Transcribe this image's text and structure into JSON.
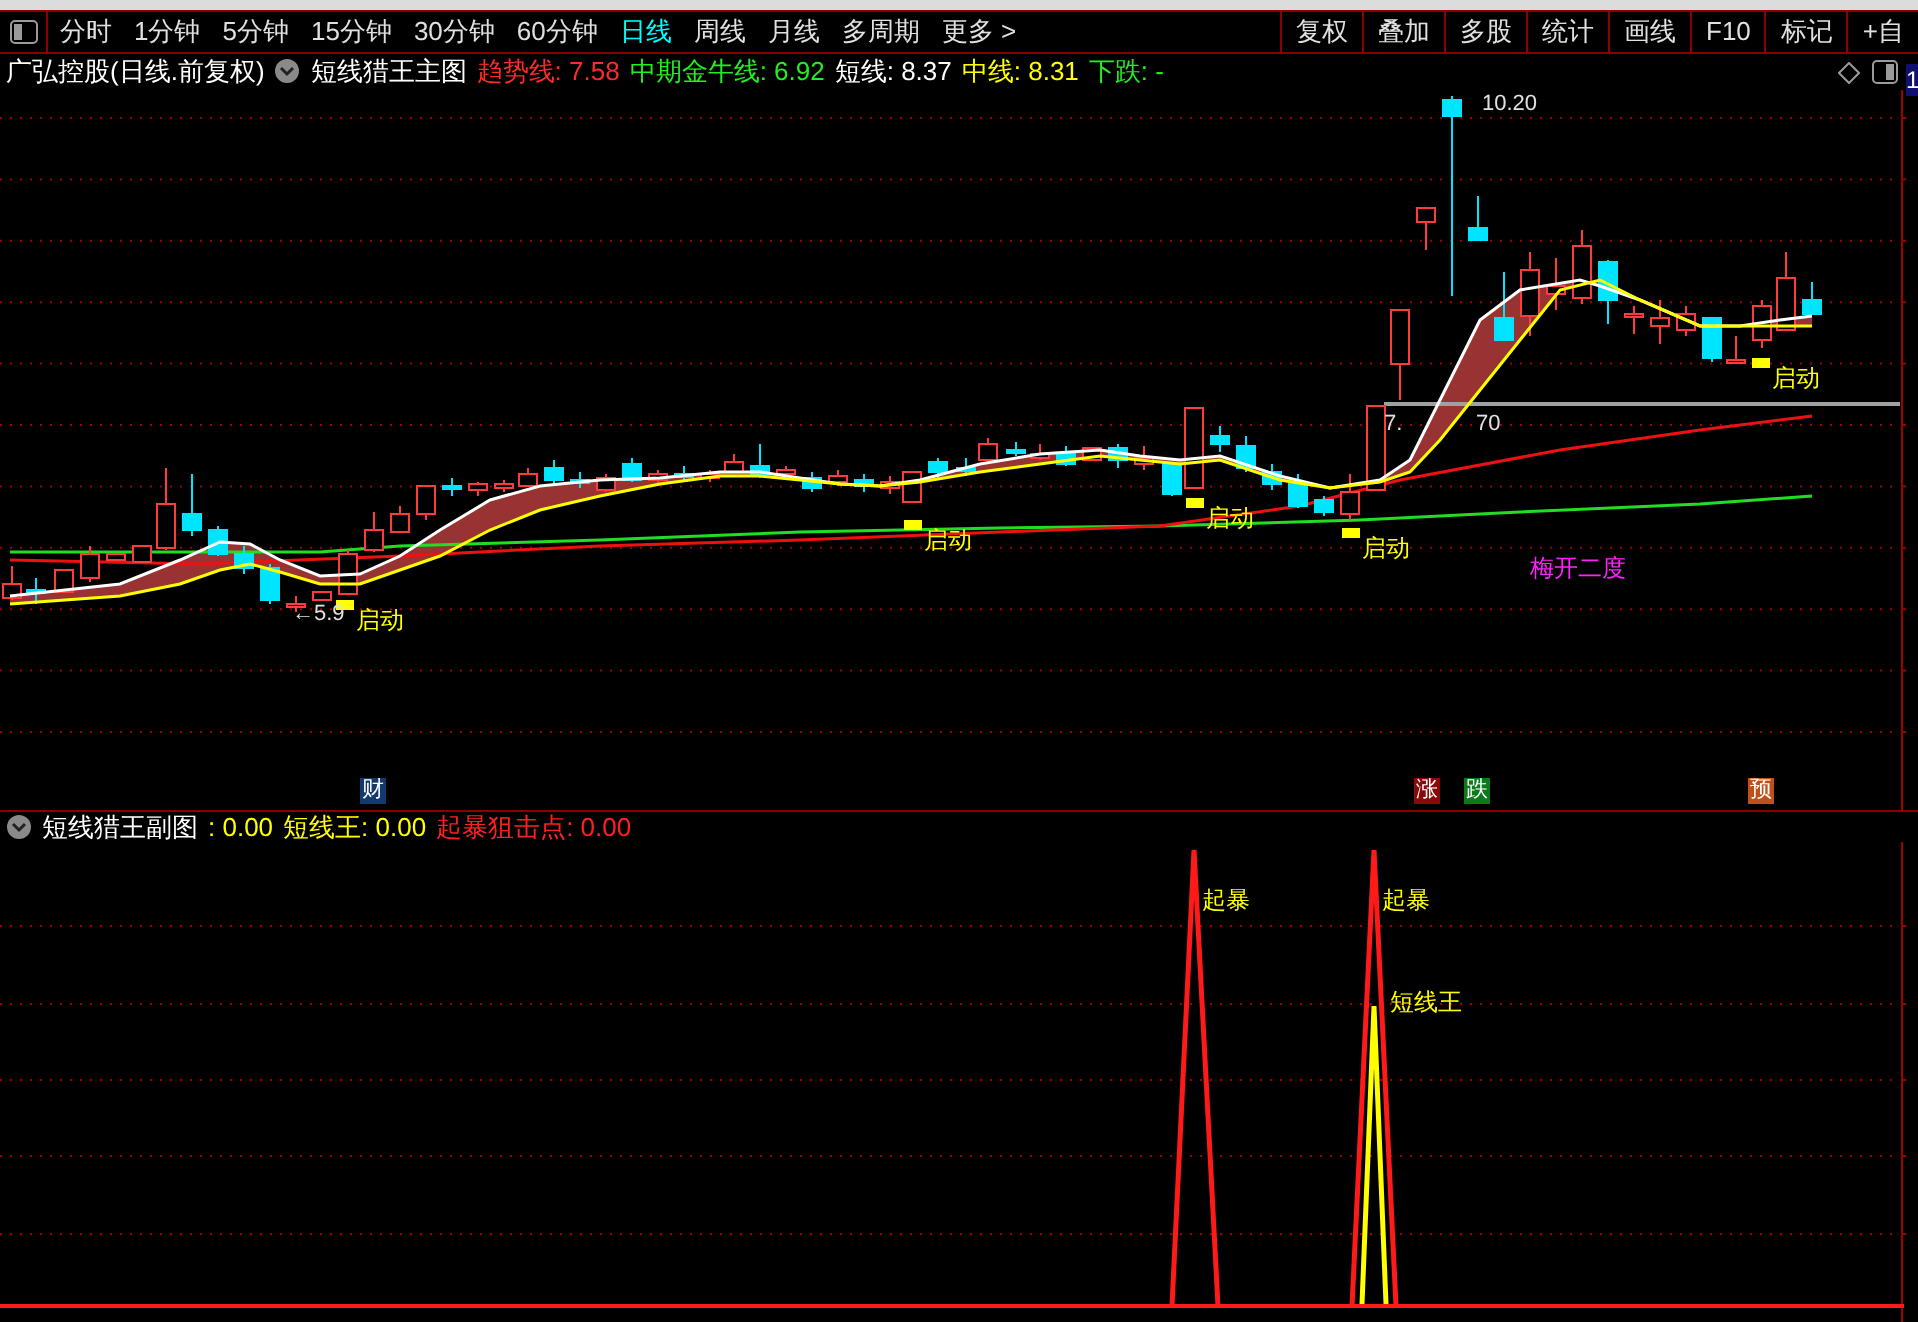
{
  "toolbar": {
    "tabs": [
      {
        "label": "分时",
        "selected": false
      },
      {
        "label": "1分钟",
        "selected": false
      },
      {
        "label": "5分钟",
        "selected": false
      },
      {
        "label": "15分钟",
        "selected": false
      },
      {
        "label": "30分钟",
        "selected": false
      },
      {
        "label": "60分钟",
        "selected": false
      },
      {
        "label": "日线",
        "selected": true
      },
      {
        "label": "周线",
        "selected": false
      },
      {
        "label": "月线",
        "selected": false
      },
      {
        "label": "多周期",
        "selected": false
      },
      {
        "label": "更多 >",
        "selected": false
      }
    ],
    "buttons": [
      "复权",
      "叠加",
      "多股",
      "统计",
      "画线",
      "F10",
      "标记",
      "+自"
    ]
  },
  "main_chart": {
    "stock": "广弘控股(日线.前复权)",
    "indicator": "短线猎王主图",
    "readings": [
      {
        "text": "趋势线: 7.58",
        "color": "#ff2a2a"
      },
      {
        "text": "中期金牛线: 6.92",
        "color": "#22ee22"
      },
      {
        "text": "短线: 8.37",
        "color": "#ffffff"
      },
      {
        "text": "中线: 8.31",
        "color": "#ffff00"
      },
      {
        "text": "下跌: -",
        "color": "#22ee22"
      }
    ],
    "axis_label": "1",
    "price_labels": [
      "10.20",
      "←5.9",
      "7.",
      "70"
    ],
    "signals": [
      "启动",
      "启动",
      "启动",
      "启动",
      "启动"
    ],
    "pattern_label": "梅开二度",
    "event_markers": [
      {
        "text": "财",
        "color": "#123a6e"
      },
      {
        "text": "涨",
        "color": "#8a0a0a"
      },
      {
        "text": "跌",
        "color": "#0a7a1a"
      },
      {
        "text": "预",
        "color": "#c0501a"
      }
    ]
  },
  "sub_chart": {
    "indicator": "短线猎王副图",
    "readings": [
      {
        "text": ": 0.00",
        "color": "#ffff00"
      },
      {
        "text": "短线王: 0.00",
        "color": "#ffff00"
      },
      {
        "text": "起暴狙击点: 0.00",
        "color": "#ff2020"
      }
    ],
    "labels": [
      {
        "kind": "burst",
        "text": "起暴"
      },
      {
        "kind": "burst",
        "text": "起暴"
      },
      {
        "kind": "king",
        "text": "短线王"
      }
    ]
  }
}
